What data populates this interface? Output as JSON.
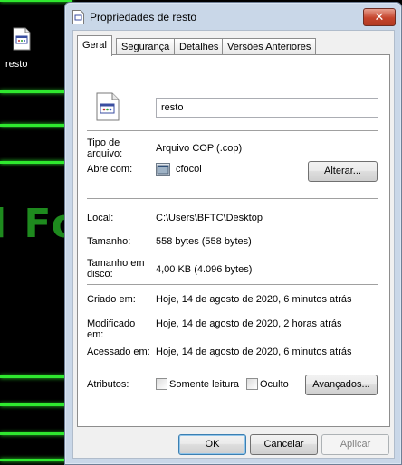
{
  "desktop": {
    "icon_label": "resto",
    "background_text": "l Fo"
  },
  "window": {
    "title": "Propriedades de resto",
    "close_symbol": "✕"
  },
  "tabs": [
    {
      "label": "Geral",
      "active": true
    },
    {
      "label": "Segurança"
    },
    {
      "label": "Detalhes"
    },
    {
      "label": "Versões Anteriores"
    }
  ],
  "general": {
    "file_name": "resto",
    "type_label": "Tipo de arquivo:",
    "type_value": "Arquivo COP (.cop)",
    "opens_with_label": "Abre com:",
    "opens_with_value": "cfocol",
    "change_button": "Alterar...",
    "location_label": "Local:",
    "location_value": "C:\\Users\\BFTC\\Desktop",
    "size_label": "Tamanho:",
    "size_value": "558 bytes (558 bytes)",
    "size_on_disk_label": "Tamanho em disco:",
    "size_on_disk_value": "4,00 KB (4.096 bytes)",
    "created_label": "Criado em:",
    "created_value": "Hoje, 14 de agosto de 2020, 6 minutos atrás",
    "modified_label": "Modificado em:",
    "modified_value": "Hoje, 14 de agosto de 2020, 2 horas atrás",
    "accessed_label": "Acessado em:",
    "accessed_value": "Hoje, 14 de agosto de 2020, 6 minutos atrás",
    "attributes_label": "Atributos:",
    "readonly_label": "Somente leitura",
    "hidden_label": "Oculto",
    "advanced_button": "Avançados..."
  },
  "footer": {
    "ok": "OK",
    "cancel": "Cancelar",
    "apply": "Aplicar"
  }
}
